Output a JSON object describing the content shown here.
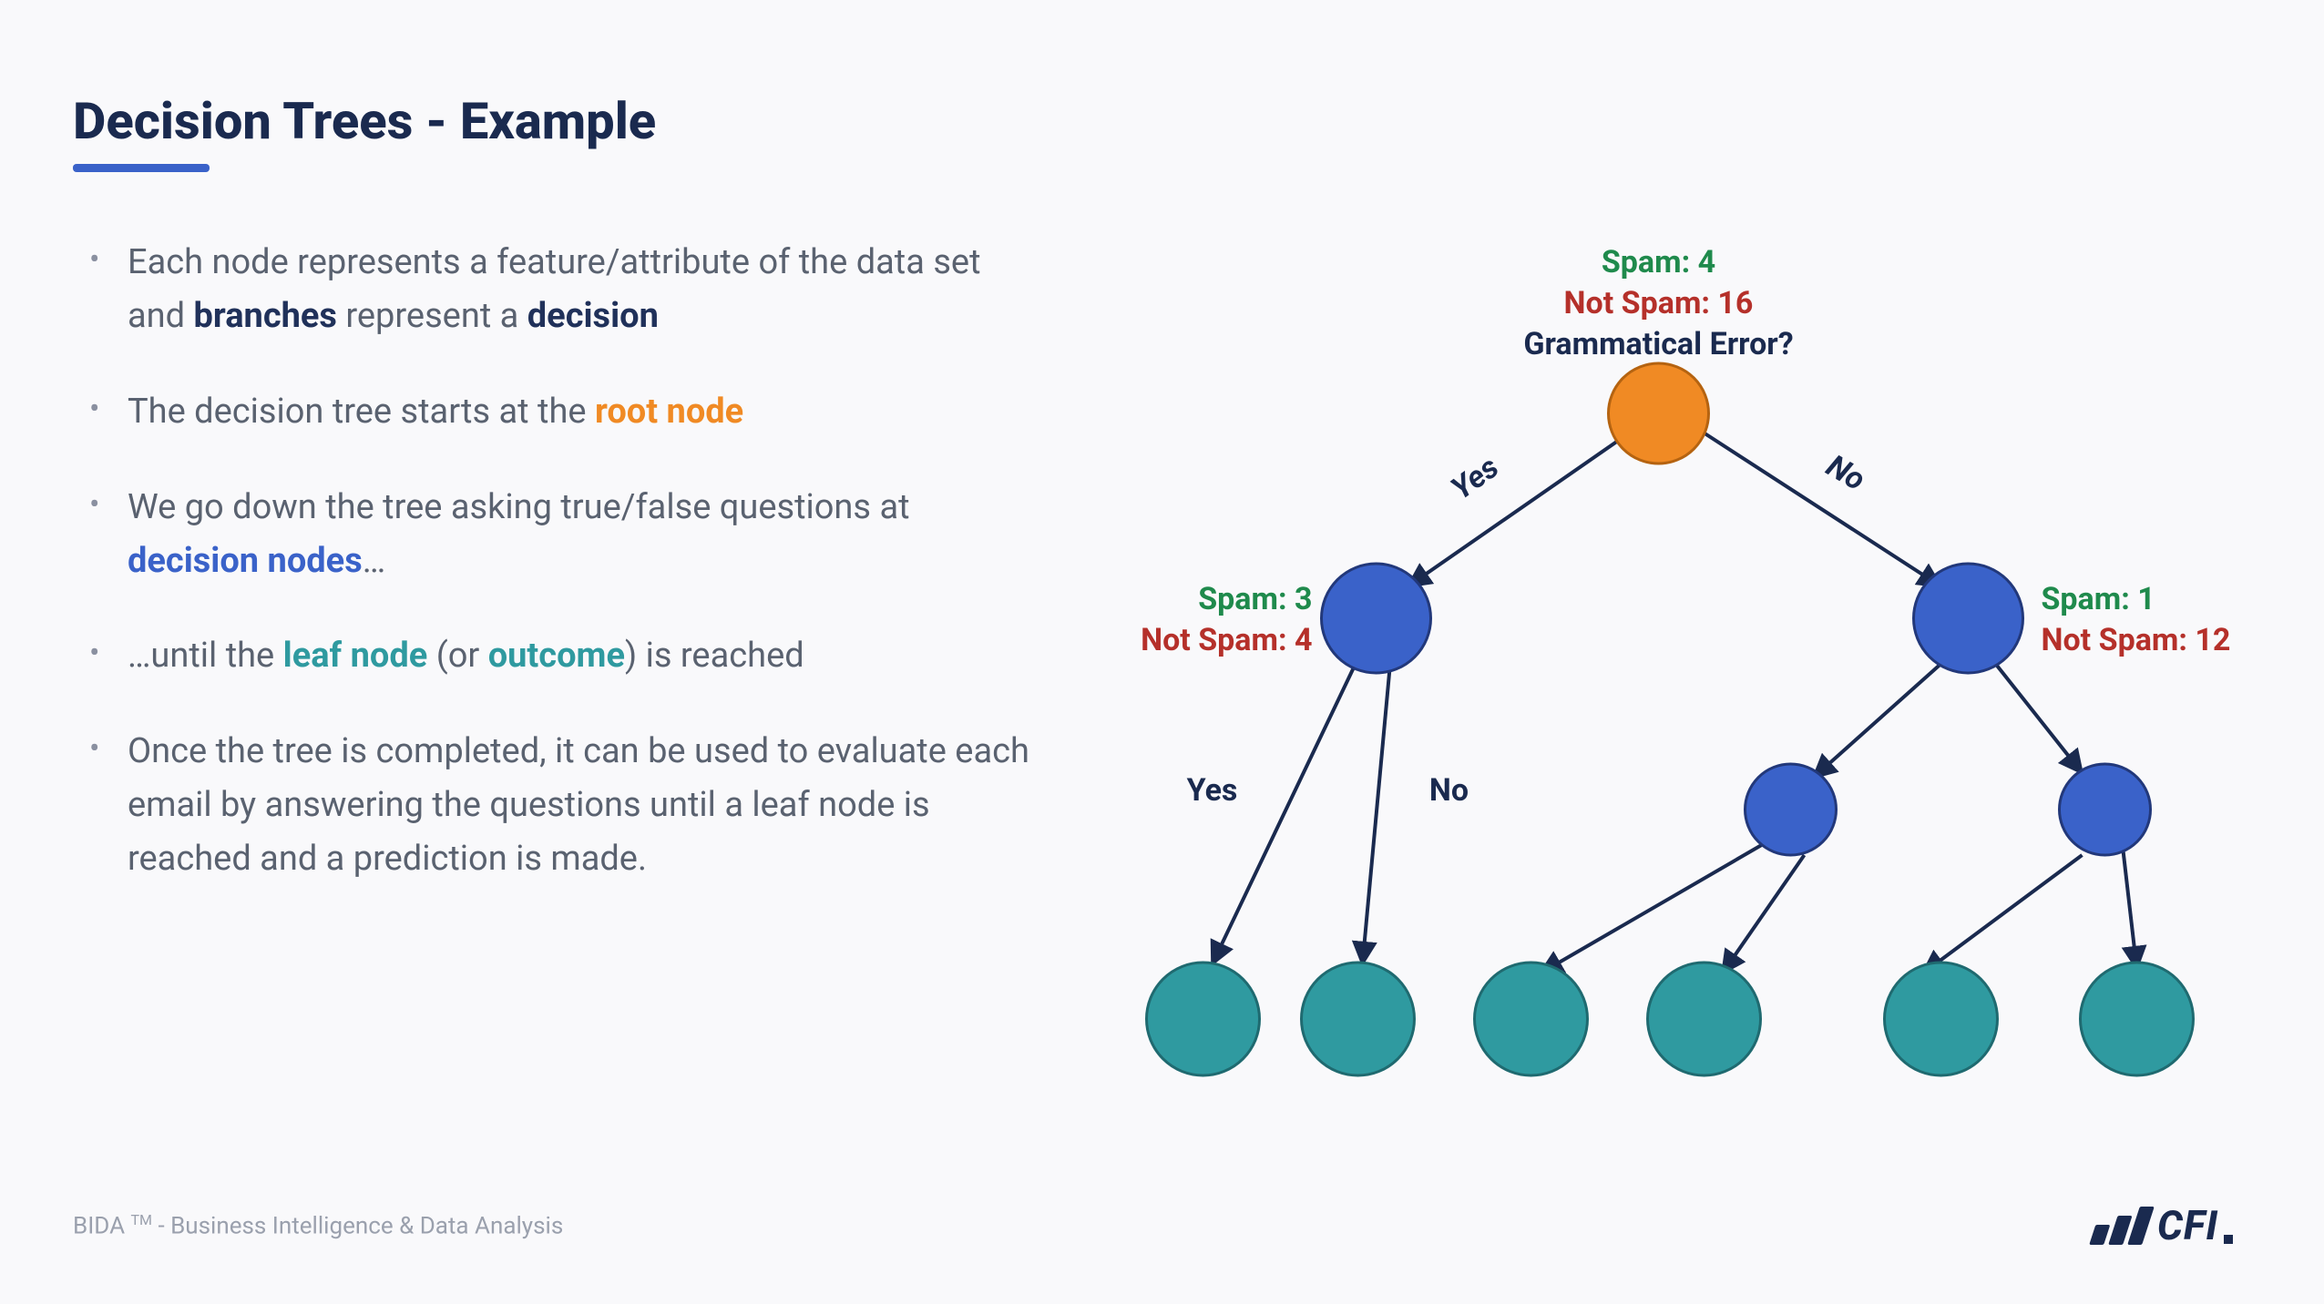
{
  "title": "Decision Trees - Example",
  "bullets": {
    "b1a": "Each node represents a feature/attribute of the data set and ",
    "b1b": "branches",
    "b1c": " represent a ",
    "b1d": "decision",
    "b2a": "The decision tree starts at the ",
    "b2b": "root node",
    "b3a": "We go down the tree asking true/false questions at ",
    "b3b": "decision nodes",
    "b3c": "…",
    "b4a": "…until the ",
    "b4b": "leaf node",
    "b4c": " (or ",
    "b4d": "outcome",
    "b4e": ") is reached",
    "b5": "Once the tree is completed, it can be used to evaluate each email by answering the questions until a leaf node is reached and a prediction is made."
  },
  "tree": {
    "root": {
      "spam_label": "Spam: 4",
      "notspam_label": "Not Spam: 16",
      "question": "Grammatical Error?",
      "spam": 4,
      "not_spam": 16
    },
    "left": {
      "spam_label": "Spam: 3",
      "notspam_label": "Not Spam: 4",
      "spam": 3,
      "not_spam": 4
    },
    "right": {
      "spam_label": "Spam: 1",
      "notspam_label": "Not Spam: 12",
      "spam": 1,
      "not_spam": 12
    },
    "edge_yes": "Yes",
    "edge_no": "No",
    "edge_yes2": "Yes",
    "edge_no2": "No"
  },
  "footer": {
    "prefix": "BIDA",
    "tm": "TM",
    "rest": " - Business Intelligence & Data Analysis"
  },
  "logo": {
    "text": "CFI"
  },
  "colors": {
    "root": "#f08a24",
    "decision": "#3a62c9",
    "leaf": "#2f9aa0",
    "green": "#1f8a4c",
    "red": "#b5302a",
    "navy": "#1a2a4f"
  }
}
